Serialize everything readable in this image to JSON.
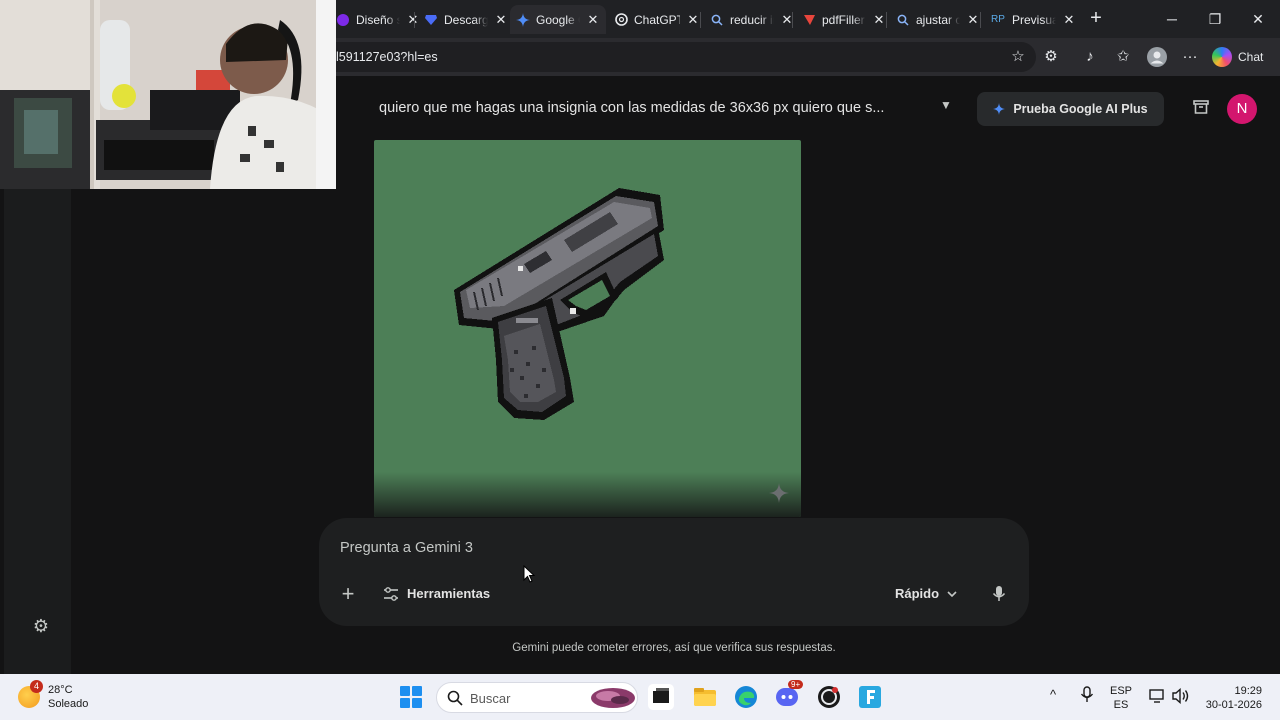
{
  "browser": {
    "tabs": [
      {
        "title": "Diseño sin título",
        "favicon": "canva-icon",
        "color": "#7d2ae8",
        "active": false
      },
      {
        "title": "Descargar",
        "favicon": "diamond-icon",
        "color": "#4a6cf7",
        "active": false
      },
      {
        "title": "Google Gemini",
        "favicon": "gemini-icon",
        "color": "#4f8df7",
        "active": true
      },
      {
        "title": "ChatGPT",
        "favicon": "openai-icon",
        "color": "#e8eaed",
        "active": false
      },
      {
        "title": "reducir imagen",
        "favicon": "search-icon",
        "color": "#8ab4f8",
        "active": false
      },
      {
        "title": "pdfFiller",
        "favicon": "pdffiller-icon",
        "color": "#e8453c",
        "active": false
      },
      {
        "title": "ajustar calidad",
        "favicon": "search-icon",
        "color": "#8ab4f8",
        "active": false
      },
      {
        "title": "Previsualizar",
        "favicon": "rp-icon",
        "color": "#5aa9e6",
        "active": false
      }
    ],
    "url": "l591127e03?hl=es",
    "chat_label": "Chat"
  },
  "gemini": {
    "prompt_title": "quiero que me hagas una insignia con las medidas de  36x36 px quiero que s...",
    "ai_plus_label": "Prueba Google AI Plus",
    "avatar_letter": "N",
    "composer_placeholder": "Pregunta a Gemini 3",
    "tools_label": "Herramientas",
    "mode_label": "Rápido",
    "disclaimer": "Gemini puede cometer errores, así que verifica sus respuestas.",
    "image_background": "#4d7f57",
    "accent": "#d3166e"
  },
  "taskbar": {
    "weather_temp": "28°C",
    "weather_desc": "Soleado",
    "weather_badge": "4",
    "search_label": "Buscar",
    "lang_top": "ESP",
    "lang_bottom": "ES",
    "time": "19:29",
    "date": "30-01-2026",
    "discord_badge": "9+"
  }
}
